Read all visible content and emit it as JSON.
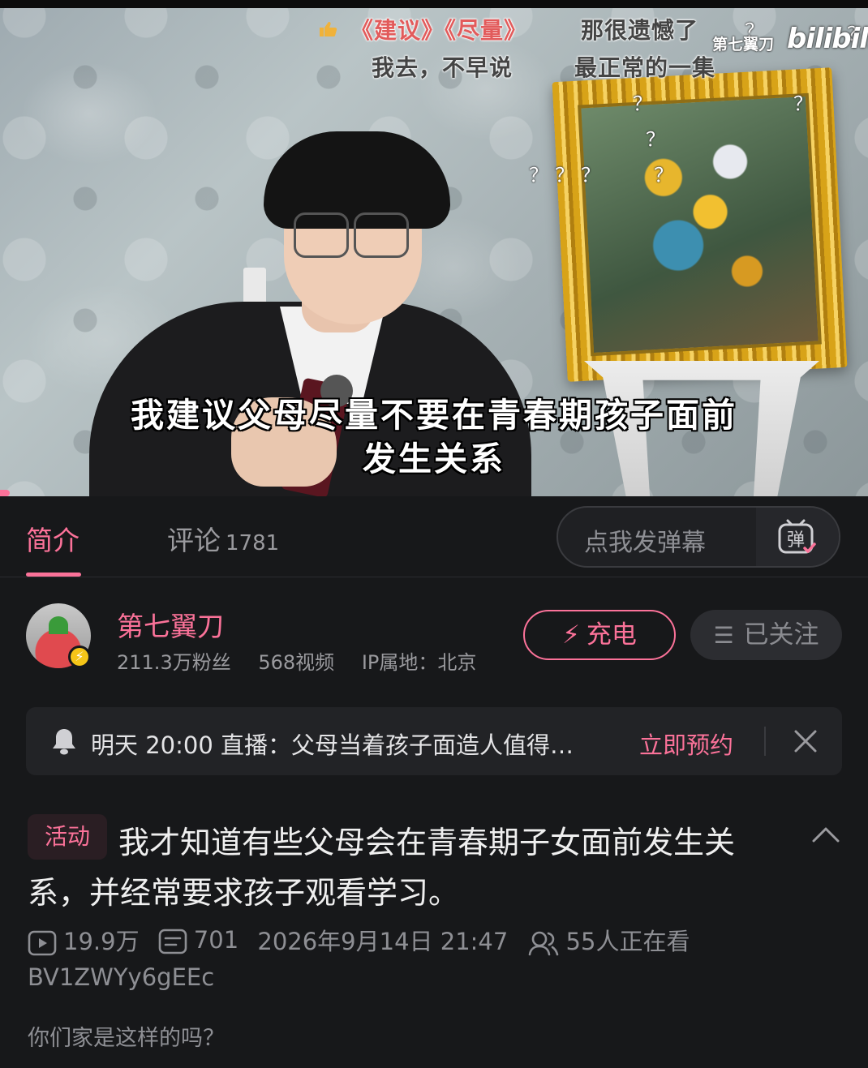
{
  "video": {
    "danmaku": [
      {
        "text": "《建议》《尽量》",
        "style": "red"
      },
      {
        "text": "那很遗憾了",
        "style": "normal"
      },
      {
        "text": "我去，不早说",
        "style": "normal"
      },
      {
        "text": "最正常的一集",
        "style": "normal"
      },
      {
        "text": "？",
        "style": "q"
      },
      {
        "text": "？",
        "style": "q"
      },
      {
        "text": "？",
        "style": "q"
      },
      {
        "text": "？",
        "style": "q"
      },
      {
        "text": "？",
        "style": "q"
      },
      {
        "text": "？",
        "style": "q"
      },
      {
        "text": "？",
        "style": "q"
      },
      {
        "text": "？",
        "style": "q"
      },
      {
        "text": "？",
        "style": "q"
      }
    ],
    "watermark_author": "第七翼刀",
    "watermark_logo": "bilibili",
    "subtitle_line1": "我建议父母尽量不要在青春期孩子面前",
    "subtitle_line2": "发生关系"
  },
  "tabs": {
    "intro_label": "简介",
    "comments_label": "评论",
    "comments_count": "1781"
  },
  "danmaku_input": {
    "placeholder": "点我发弹幕",
    "toggle_icon": "弹"
  },
  "uploader": {
    "name": "第七翼刀",
    "fans": "211.3万粉丝",
    "videos": "568视频",
    "ip": "IP属地：北京",
    "charge_label": "充电",
    "follow_label": "已关注"
  },
  "live_banner": {
    "text": "明天 20:00 直播：父母当着孩子面造人值得…",
    "action": "立即预约"
  },
  "title": {
    "tag": "活动",
    "text": "我才知道有些父母会在青春期子女面前发生关系，并经常要求孩子观看学习。"
  },
  "meta": {
    "plays": "19.9万",
    "danmaku_count": "701",
    "datetime": "2026年9月14日 21:47",
    "watching": "55人正在看",
    "bvid": "BV1ZWYy6gEEc"
  },
  "description": "你们家是这样的吗？",
  "colors": {
    "accent": "#fb7299",
    "background": "#17181a",
    "muted": "#8e8f94"
  }
}
